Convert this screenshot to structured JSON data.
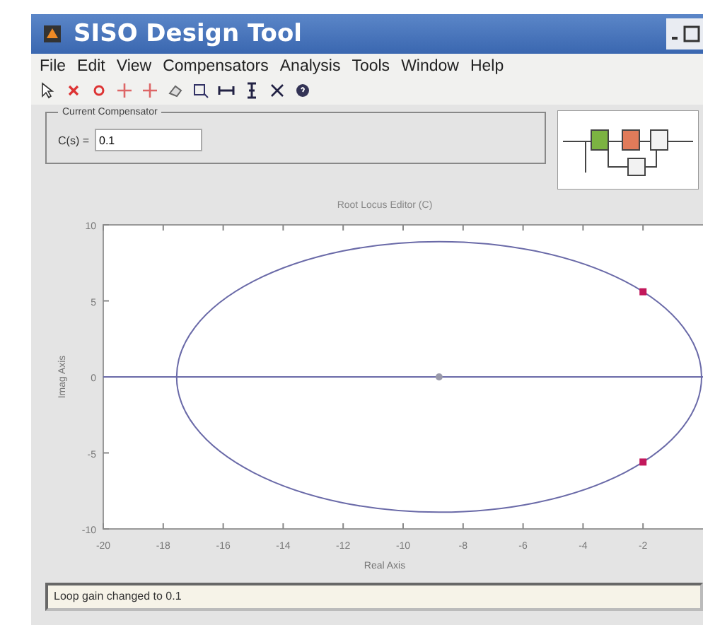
{
  "window": {
    "title": "SISO Design Tool"
  },
  "menu": [
    "File",
    "Edit",
    "View",
    "Compensators",
    "Analysis",
    "Tools",
    "Window",
    "Help"
  ],
  "compensator": {
    "legend": "Current Compensator",
    "label": "C(s) =",
    "value": "0.1"
  },
  "plot": {
    "chart_data": {
      "type": "scatter",
      "title": "Root Locus Editor (C)",
      "xlabel": "Real Axis",
      "ylabel": "Imag Axis",
      "xlim": [
        -20,
        0
      ],
      "ylim": [
        -10,
        10
      ],
      "xticks": [
        -20,
        -18,
        -16,
        -14,
        -12,
        -10,
        -8,
        -6,
        -4,
        -2
      ],
      "yticks": [
        -10,
        -5,
        0,
        5,
        10
      ],
      "x": [
        -2,
        -2
      ],
      "ref_lines": [
        {
          "axis": "y",
          "value": 0,
          "color": "#6a6aa8"
        }
      ],
      "series": [
        {
          "color": "#c2185b",
          "values": [
            5.6,
            -5.6
          ]
        }
      ]
    }
  },
  "status_bar": "Loop gain changed to 0.1"
}
